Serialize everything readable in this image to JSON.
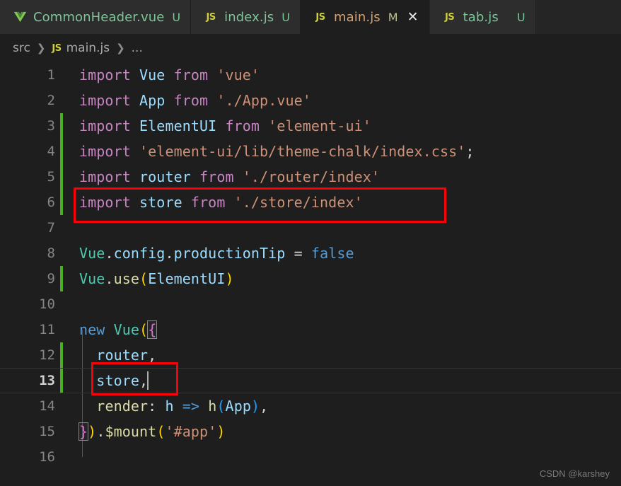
{
  "tabs": [
    {
      "label": "CommonHeader.vue",
      "icon": "vue-icon",
      "badge": "U",
      "badge_type": "untracked",
      "active": false,
      "closable": false
    },
    {
      "label": "index.js",
      "icon": "js-icon",
      "badge": "U",
      "badge_type": "untracked",
      "active": false,
      "closable": false
    },
    {
      "label": "main.js",
      "icon": "js-icon",
      "badge": "M",
      "badge_type": "modified",
      "active": true,
      "closable": true,
      "close_label": "✕"
    },
    {
      "label": "tab.js",
      "icon": "js-icon",
      "badge": "U",
      "badge_type": "untracked",
      "active": false,
      "closable": false
    }
  ],
  "breadcrumb": {
    "root": "src",
    "separator": "❯",
    "file": "main.js",
    "file_icon": "js-icon",
    "tail": "..."
  },
  "editor": {
    "language": "javascript",
    "current_line": 13,
    "cursor_line": 13,
    "cursor_column": 9,
    "lines": [
      {
        "n": "1",
        "changed": false,
        "text": "import Vue from 'vue'"
      },
      {
        "n": "2",
        "changed": false,
        "text": "import App from './App.vue'"
      },
      {
        "n": "3",
        "changed": true,
        "text": "import ElementUI from 'element-ui'"
      },
      {
        "n": "4",
        "changed": true,
        "text": "import 'element-ui/lib/theme-chalk/index.css';"
      },
      {
        "n": "5",
        "changed": true,
        "text": "import router from './router/index'"
      },
      {
        "n": "6",
        "changed": true,
        "text": "import store from './store/index'"
      },
      {
        "n": "7",
        "changed": false,
        "text": ""
      },
      {
        "n": "8",
        "changed": false,
        "text": "Vue.config.productionTip = false"
      },
      {
        "n": "9",
        "changed": true,
        "text": "Vue.use(ElementUI)"
      },
      {
        "n": "10",
        "changed": false,
        "text": ""
      },
      {
        "n": "11",
        "changed": false,
        "text": "new Vue({"
      },
      {
        "n": "12",
        "changed": true,
        "text": "  router,"
      },
      {
        "n": "13",
        "changed": true,
        "text": "  store,"
      },
      {
        "n": "14",
        "changed": false,
        "text": "  render: h => h(App),"
      },
      {
        "n": "15",
        "changed": false,
        "text": "}).$mount('#app')"
      },
      {
        "n": "16",
        "changed": false,
        "text": ""
      }
    ]
  },
  "annotations": [
    {
      "name": "import-store-highlight",
      "target_line": 6
    },
    {
      "name": "store-property-highlight",
      "target_line": 13
    }
  ],
  "watermark": "CSDN @karshey",
  "colors": {
    "annotation": "#fb0007",
    "gutter_change": "#4caf1f",
    "editor_bg": "#1e1e1e",
    "tab_inactive_bg": "#2d2d2d",
    "tab_active_bg": "#1e1e1e",
    "keyword": "#c586c0",
    "identifier": "#9cdcfe",
    "string": "#ce9178",
    "type": "#4ec9b0",
    "function": "#dcdcaa",
    "blue_keyword": "#569cd6"
  }
}
